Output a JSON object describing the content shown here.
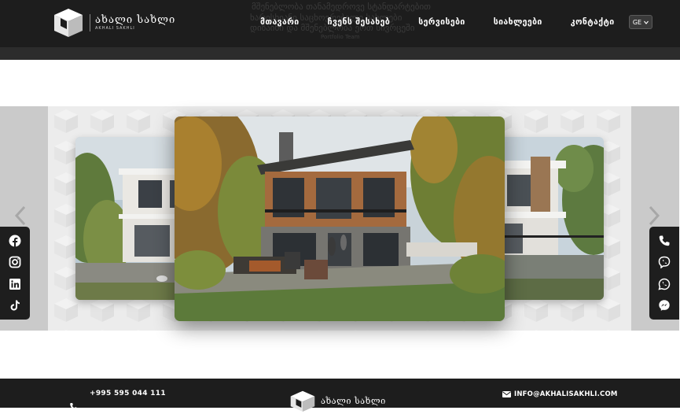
{
  "header": {
    "logo": {
      "title": "ახალი სახლი",
      "subtitle": "AKHALI SAKHLI"
    },
    "nav": [
      {
        "label": "მთავარი"
      },
      {
        "label": "ჩვენს შესახებ"
      },
      {
        "label": "სერვისები"
      },
      {
        "label": "სიახლეები"
      },
      {
        "label": "კონტაქტი"
      }
    ],
    "language": "GE",
    "ghost_text": [
      "მშენებლობა თანამედროვე სტანდარტებით",
      "ხარისხიანი საცხოვრებელი სახლები",
      "დიზაინი და მშენებლობა ერთ სივრცეში",
      "Portfolio Team"
    ]
  },
  "gallery": {
    "prev_icon": "chevron-left-icon",
    "next_icon": "chevron-right-icon",
    "slides": [
      {
        "name": "modern-villa-left"
      },
      {
        "name": "two-story-house-center"
      },
      {
        "name": "modern-villa-right"
      }
    ]
  },
  "social": {
    "left": [
      "facebook-icon",
      "instagram-icon",
      "linkedin-icon",
      "tiktok-icon"
    ],
    "right": [
      "phone-icon",
      "viber-icon",
      "whatsapp-icon",
      "messenger-icon"
    ]
  },
  "footer": {
    "phone": "+995 595 044 111",
    "logo_title": "ახალი სახლი",
    "email": "INFO@AKHALISAKHLI.COM"
  },
  "colors": {
    "dark": "#1d1d1d",
    "panel": "#ececec",
    "side": "#cacaca"
  }
}
